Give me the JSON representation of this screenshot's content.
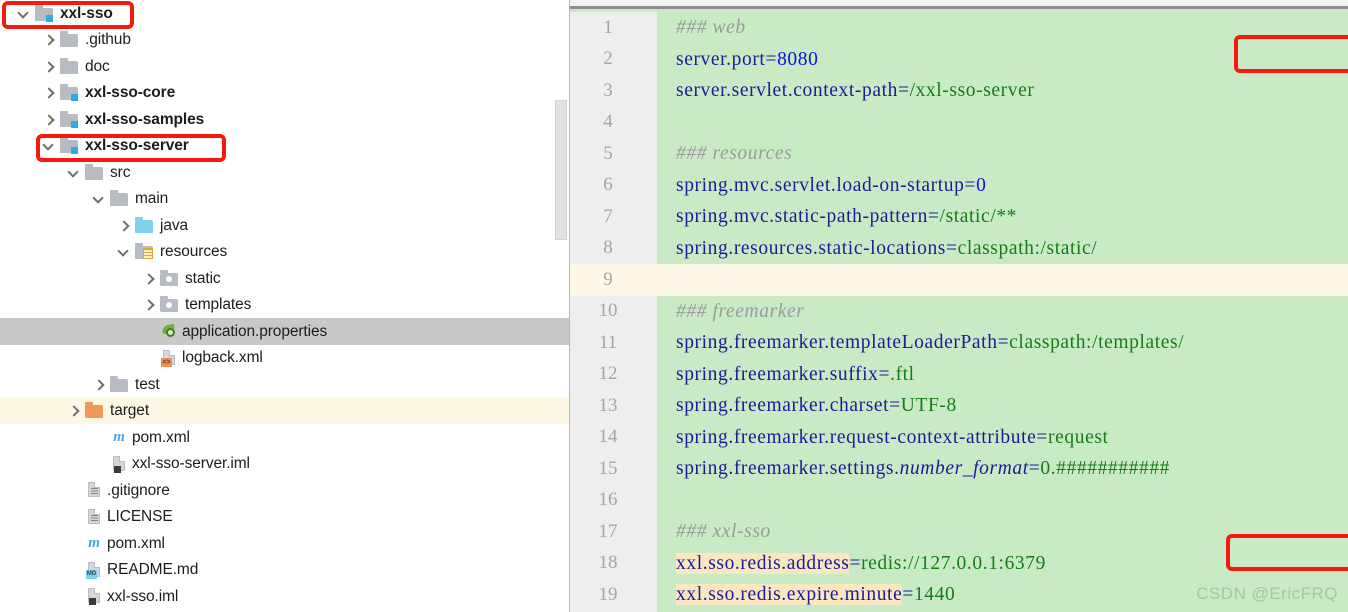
{
  "window": {
    "watermark": "CSDN @EricFRQ"
  },
  "tree": {
    "name": "project-tree",
    "items": [
      {
        "label": "xxl-sso",
        "indent": 0,
        "arrow": "down",
        "icon": "folder-module",
        "bold": true,
        "state": "normal"
      },
      {
        "label": ".github",
        "indent": 1,
        "arrow": "right",
        "icon": "folder",
        "bold": false,
        "state": "normal"
      },
      {
        "label": "doc",
        "indent": 1,
        "arrow": "right",
        "icon": "folder",
        "bold": false,
        "state": "normal"
      },
      {
        "label": "xxl-sso-core",
        "indent": 1,
        "arrow": "right",
        "icon": "folder-module",
        "bold": true,
        "state": "normal"
      },
      {
        "label": "xxl-sso-samples",
        "indent": 1,
        "arrow": "right",
        "icon": "folder-module",
        "bold": true,
        "state": "normal"
      },
      {
        "label": "xxl-sso-server",
        "indent": 1,
        "arrow": "down",
        "icon": "folder-module",
        "bold": true,
        "state": "normal"
      },
      {
        "label": "src",
        "indent": 2,
        "arrow": "down",
        "icon": "folder",
        "bold": false,
        "state": "normal"
      },
      {
        "label": "main",
        "indent": 3,
        "arrow": "down",
        "icon": "folder",
        "bold": false,
        "state": "normal"
      },
      {
        "label": "java",
        "indent": 4,
        "arrow": "right",
        "icon": "folder-source",
        "bold": false,
        "state": "normal"
      },
      {
        "label": "resources",
        "indent": 4,
        "arrow": "down",
        "icon": "folder-resources",
        "bold": false,
        "state": "normal"
      },
      {
        "label": "static",
        "indent": 5,
        "arrow": "right",
        "icon": "folder-dot",
        "bold": false,
        "state": "normal"
      },
      {
        "label": "templates",
        "indent": 5,
        "arrow": "right",
        "icon": "folder-dot",
        "bold": false,
        "state": "normal"
      },
      {
        "label": "application.properties",
        "indent": 5,
        "arrow": "none",
        "icon": "spring-file",
        "bold": false,
        "state": "selected"
      },
      {
        "label": "logback.xml",
        "indent": 5,
        "arrow": "none",
        "icon": "xml-file",
        "bold": false,
        "state": "normal"
      },
      {
        "label": "test",
        "indent": 3,
        "arrow": "right",
        "icon": "folder",
        "bold": false,
        "state": "normal"
      },
      {
        "label": "target",
        "indent": 2,
        "arrow": "right",
        "icon": "folder-excluded",
        "bold": false,
        "state": "warm"
      },
      {
        "label": "pom.xml",
        "indent": 3,
        "arrow": "none",
        "icon": "maven-file",
        "bold": false,
        "state": "normal"
      },
      {
        "label": "xxl-sso-server.iml",
        "indent": 3,
        "arrow": "none",
        "icon": "iml-file",
        "bold": false,
        "state": "normal"
      },
      {
        "label": ".gitignore",
        "indent": 2,
        "arrow": "none",
        "icon": "text-file",
        "bold": false,
        "state": "normal"
      },
      {
        "label": "LICENSE",
        "indent": 2,
        "arrow": "none",
        "icon": "text-file",
        "bold": false,
        "state": "normal"
      },
      {
        "label": "pom.xml",
        "indent": 2,
        "arrow": "none",
        "icon": "maven-file",
        "bold": false,
        "state": "normal"
      },
      {
        "label": "README.md",
        "indent": 2,
        "arrow": "none",
        "icon": "md-file",
        "bold": false,
        "state": "normal"
      },
      {
        "label": "xxl-sso.iml",
        "indent": 2,
        "arrow": "none",
        "icon": "iml-file",
        "bold": false,
        "state": "normal"
      }
    ]
  },
  "editor": {
    "name": "application.properties",
    "lines": [
      {
        "n": "1",
        "cursor": false,
        "tokens": [
          {
            "t": "### web",
            "c": "cm"
          }
        ]
      },
      {
        "n": "2",
        "cursor": false,
        "tokens": [
          {
            "t": "server.port",
            "c": "k"
          },
          {
            "t": "=",
            "c": "eq"
          },
          {
            "t": "8080",
            "c": "vn"
          }
        ]
      },
      {
        "n": "3",
        "cursor": false,
        "tokens": [
          {
            "t": "server.servlet.context-path",
            "c": "k"
          },
          {
            "t": "=",
            "c": "eq"
          },
          {
            "t": "/xxl-sso-server",
            "c": "v"
          }
        ]
      },
      {
        "n": "4",
        "cursor": false,
        "tokens": []
      },
      {
        "n": "5",
        "cursor": false,
        "tokens": [
          {
            "t": "### resources",
            "c": "cm"
          }
        ]
      },
      {
        "n": "6",
        "cursor": false,
        "tokens": [
          {
            "t": "spring.mvc.servlet.load-on-startup",
            "c": "k"
          },
          {
            "t": "=",
            "c": "eq"
          },
          {
            "t": "0",
            "c": "vn"
          }
        ]
      },
      {
        "n": "7",
        "cursor": false,
        "tokens": [
          {
            "t": "spring.mvc.static-path-pattern",
            "c": "k"
          },
          {
            "t": "=",
            "c": "eq"
          },
          {
            "t": "/static/**",
            "c": "v"
          }
        ]
      },
      {
        "n": "8",
        "cursor": false,
        "tokens": [
          {
            "t": "spring.resources.static-locations",
            "c": "k"
          },
          {
            "t": "=",
            "c": "eq"
          },
          {
            "t": "classpath:/static/",
            "c": "v"
          }
        ]
      },
      {
        "n": "9",
        "cursor": true,
        "tokens": []
      },
      {
        "n": "10",
        "cursor": false,
        "tokens": [
          {
            "t": "### freemarker",
            "c": "cm"
          }
        ]
      },
      {
        "n": "11",
        "cursor": false,
        "tokens": [
          {
            "t": "spring.freemarker.templateLoaderPath",
            "c": "k"
          },
          {
            "t": "=",
            "c": "eq"
          },
          {
            "t": "classpath:/templates/",
            "c": "v"
          }
        ]
      },
      {
        "n": "12",
        "cursor": false,
        "tokens": [
          {
            "t": "spring.freemarker.suffix",
            "c": "k"
          },
          {
            "t": "=",
            "c": "eq"
          },
          {
            "t": ".ftl",
            "c": "v"
          }
        ]
      },
      {
        "n": "13",
        "cursor": false,
        "tokens": [
          {
            "t": "spring.freemarker.charset",
            "c": "k"
          },
          {
            "t": "=",
            "c": "eq"
          },
          {
            "t": "UTF-8",
            "c": "v"
          }
        ]
      },
      {
        "n": "14",
        "cursor": false,
        "tokens": [
          {
            "t": "spring.freemarker.request-context-attribute",
            "c": "k"
          },
          {
            "t": "=",
            "c": "eq"
          },
          {
            "t": "request",
            "c": "v"
          }
        ]
      },
      {
        "n": "15",
        "cursor": false,
        "tokens": [
          {
            "t": "spring.freemarker.settings.",
            "c": "k"
          },
          {
            "t": "number_format",
            "c": "k it"
          },
          {
            "t": "=",
            "c": "eq"
          },
          {
            "t": "0.###########",
            "c": "v"
          }
        ]
      },
      {
        "n": "16",
        "cursor": false,
        "tokens": []
      },
      {
        "n": "17",
        "cursor": false,
        "tokens": [
          {
            "t": "### xxl-sso",
            "c": "cm"
          }
        ]
      },
      {
        "n": "18",
        "cursor": false,
        "tokens": [
          {
            "t": "xxl.sso.redis.address",
            "c": "kh"
          },
          {
            "t": "=",
            "c": "eq"
          },
          {
            "t": "redis://127.0.0.1:6379",
            "c": "v"
          }
        ]
      },
      {
        "n": "19",
        "cursor": false,
        "tokens": [
          {
            "t": "xxl.sso.redis.expire.minute",
            "c": "kh"
          },
          {
            "t": "=",
            "c": "eq"
          },
          {
            "t": "1440",
            "c": "v"
          }
        ]
      }
    ]
  },
  "annotations": [
    {
      "id": "box-xxl-sso",
      "target": "xxl-sso",
      "color": "#f51a0e"
    },
    {
      "id": "box-xxl-sso-server",
      "target": "xxl-sso-server",
      "color": "#f51a0e"
    },
    {
      "id": "box-server-port",
      "target": "server.port=8080",
      "color": "#f51a0e"
    },
    {
      "id": "box-redis-address",
      "target": "xxl.sso.redis.address",
      "color": "#f51a0e"
    }
  ]
}
